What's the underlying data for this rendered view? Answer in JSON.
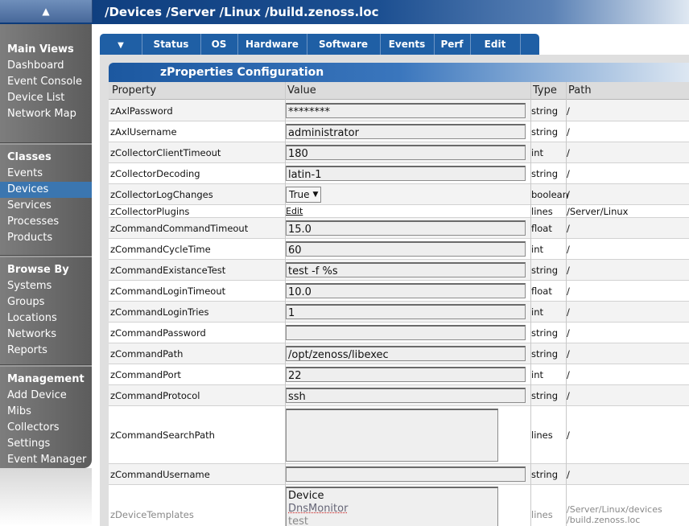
{
  "topbar": {
    "collapse_icon": "▲",
    "breadcrumb": "/Devices /Server /Linux /build.zenoss.loc"
  },
  "sidebar": {
    "sections": [
      {
        "title": "Main Views",
        "items": [
          "Dashboard",
          "Event Console",
          "Device List",
          "Network Map"
        ]
      },
      {
        "title": "Classes",
        "items": [
          "Events",
          "Devices",
          "Services",
          "Processes",
          "Products"
        ]
      },
      {
        "title": "Browse By",
        "items": [
          "Systems",
          "Groups",
          "Locations",
          "Networks",
          "Reports"
        ]
      },
      {
        "title": "Management",
        "items": [
          "Add Device",
          "Mibs",
          "Collectors",
          "Settings",
          "Event Manager"
        ]
      }
    ],
    "active_item": "Devices"
  },
  "tabs": {
    "menu_icon": "▼",
    "items": [
      "Status",
      "OS",
      "Hardware",
      "Software",
      "Events",
      "Perf",
      "Edit"
    ]
  },
  "panel": {
    "title": "zProperties Configuration",
    "headers": {
      "property": "Property",
      "value": "Value",
      "type": "Type",
      "path": "Path"
    },
    "rows": [
      {
        "property": "zAxlPassword",
        "value": "********",
        "type": "string",
        "path": "/"
      },
      {
        "property": "zAxlUsername",
        "value": "administrator",
        "type": "string",
        "path": "/"
      },
      {
        "property": "zCollectorClientTimeout",
        "value": "180",
        "type": "int",
        "path": "/"
      },
      {
        "property": "zCollectorDecoding",
        "value": "latin-1",
        "type": "string",
        "path": "/"
      },
      {
        "property": "zCollectorLogChanges",
        "value": "True",
        "type": "boolean",
        "path": "/"
      },
      {
        "property": "zCollectorPlugins",
        "value": "Edit",
        "type": "lines",
        "path": "/Server/Linux"
      },
      {
        "property": "zCommandCommandTimeout",
        "value": "15.0",
        "type": "float",
        "path": "/"
      },
      {
        "property": "zCommandCycleTime",
        "value": "60",
        "type": "int",
        "path": "/"
      },
      {
        "property": "zCommandExistanceTest",
        "value": "test -f %s",
        "type": "string",
        "path": "/"
      },
      {
        "property": "zCommandLoginTimeout",
        "value": "10.0",
        "type": "float",
        "path": "/"
      },
      {
        "property": "zCommandLoginTries",
        "value": "1",
        "type": "int",
        "path": "/"
      },
      {
        "property": "zCommandPassword",
        "value": "",
        "type": "string",
        "path": "/"
      },
      {
        "property": "zCommandPath",
        "value": "/opt/zenoss/libexec",
        "type": "string",
        "path": "/"
      },
      {
        "property": "zCommandPort",
        "value": "22",
        "type": "int",
        "path": "/"
      },
      {
        "property": "zCommandProtocol",
        "value": "ssh",
        "type": "string",
        "path": "/"
      },
      {
        "property": "zCommandSearchPath",
        "value": "",
        "type": "lines",
        "path": "/"
      },
      {
        "property": "zCommandUsername",
        "value": "",
        "type": "string",
        "path": "/"
      },
      {
        "property": "zDeviceTemplates",
        "value_lines": [
          "Device",
          "DnsMonitor",
          "test"
        ],
        "type": "lines",
        "path_lines": [
          "/Server/Linux/devices",
          "/build.zenoss.loc"
        ]
      }
    ]
  }
}
